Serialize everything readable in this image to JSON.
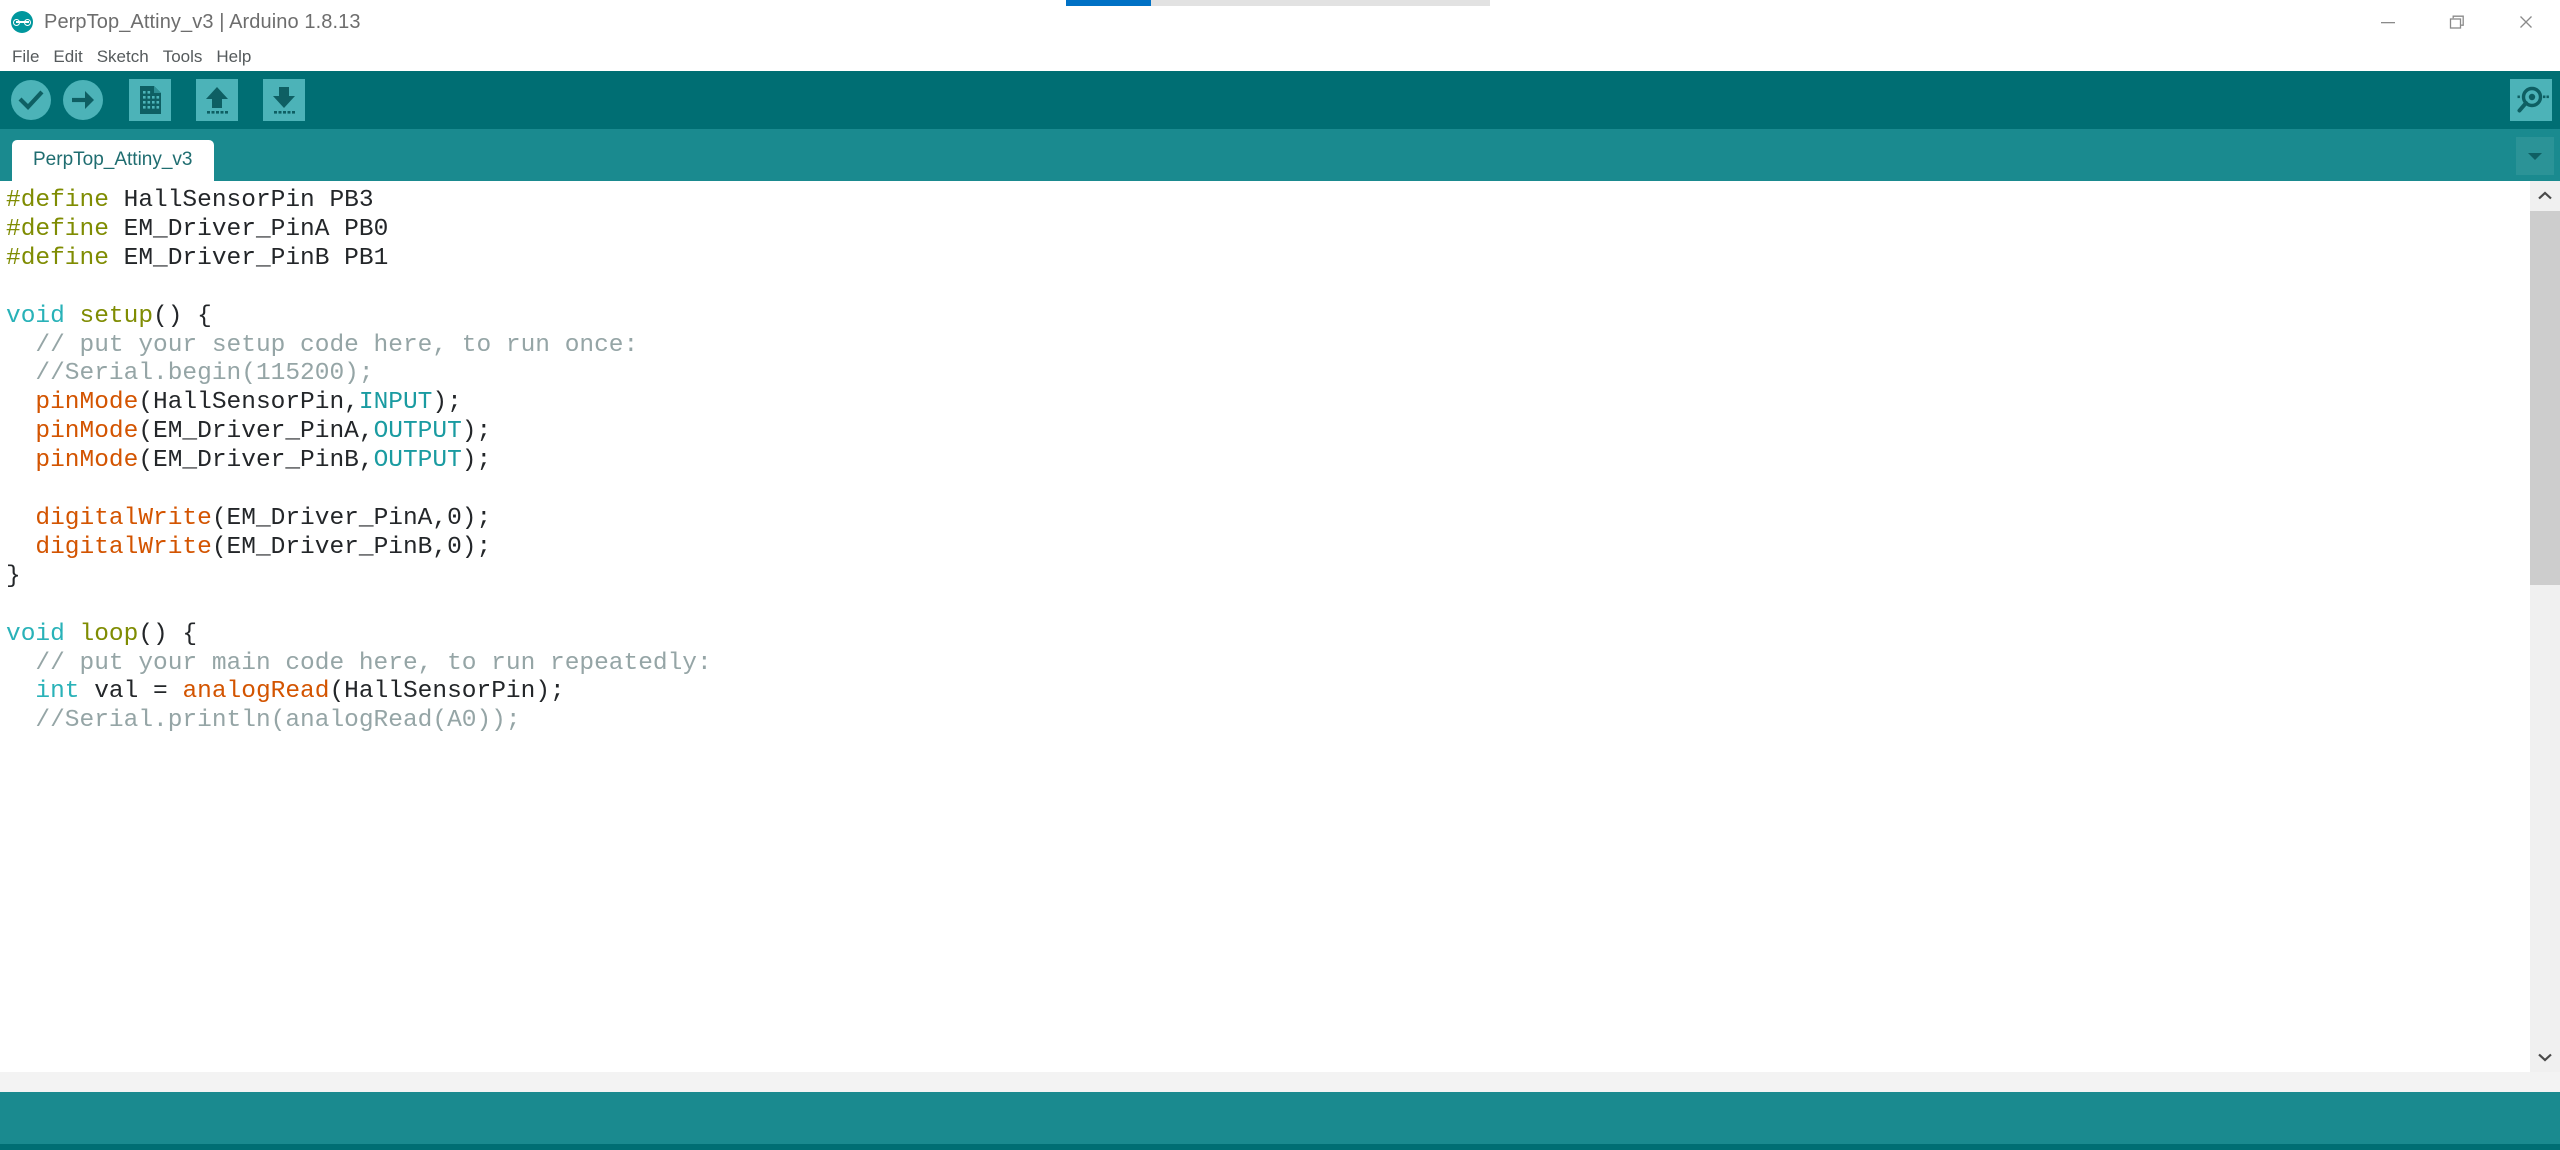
{
  "window": {
    "title": "PerpTop_Attiny_v3 | Arduino 1.8.13",
    "logo_icon": "arduino-infinity-logo-icon",
    "minimize_icon": "minimize-icon",
    "maximize_icon": "restore-window-icon",
    "close_icon": "close-icon",
    "progress": {
      "visible": true,
      "percent": 20,
      "fill_color": "#0071c5",
      "track_color": "#e2e2e2"
    }
  },
  "menubar": {
    "items": [
      {
        "label": "File"
      },
      {
        "label": "Edit"
      },
      {
        "label": "Sketch"
      },
      {
        "label": "Tools"
      },
      {
        "label": "Help"
      }
    ]
  },
  "toolbar": {
    "background": "#006e73",
    "buttons": [
      {
        "name": "verify-button",
        "icon": "checkmark-circle-icon",
        "tooltip": "Verify"
      },
      {
        "name": "upload-button",
        "icon": "arrow-right-circle-icon",
        "tooltip": "Upload"
      },
      {
        "name": "new-button",
        "icon": "new-document-icon",
        "tooltip": "New"
      },
      {
        "name": "open-button",
        "icon": "arrow-up-icon",
        "tooltip": "Open"
      },
      {
        "name": "save-button",
        "icon": "arrow-down-icon",
        "tooltip": "Save"
      }
    ],
    "serial_monitor": {
      "name": "serial-monitor-button",
      "icon": "magnifier-icon",
      "tooltip": "Serial Monitor"
    }
  },
  "tabs": {
    "background": "#1a8a8f",
    "items": [
      {
        "label": "PerpTop_Attiny_v3",
        "active": true
      }
    ],
    "menu_icon": "chevron-down-icon"
  },
  "editor": {
    "font_size_px": 24.5,
    "background": "#ffffff",
    "scrollbar": {
      "up_icon": "chevron-up-icon",
      "down_icon": "chevron-down-icon",
      "thumb_top_percent": 0,
      "thumb_height_percent": 45
    },
    "code_lines": [
      "#define HallSensorPin PB3",
      "#define EM_Driver_PinA PB0",
      "#define EM_Driver_PinB PB1",
      "",
      "void setup() {",
      "  // put your setup code here, to run once:",
      "  //Serial.begin(115200);",
      "  pinMode(HallSensorPin,INPUT);",
      "  pinMode(EM_Driver_PinA,OUTPUT);",
      "  pinMode(EM_Driver_PinB,OUTPUT);",
      "",
      "  digitalWrite(EM_Driver_PinA,0);",
      "  digitalWrite(EM_Driver_PinB,0);",
      "}",
      "",
      "void loop() {",
      "  // put your main code here, to run repeatedly:",
      "  int val = analogRead(HallSensorPin);",
      "  //Serial.println(analogRead(A0));"
    ],
    "syntax_colors": {
      "preprocessor": "#7f8c02",
      "keyword": "#29b2b8",
      "function_name": "#7f8c02",
      "builtin_call": "#d35400",
      "constant": "#1a9ba1",
      "comment": "#95a5a6",
      "plain": "#232629"
    }
  },
  "status": {
    "message": "",
    "console_text": "",
    "console_background": "#1a8a8f"
  }
}
